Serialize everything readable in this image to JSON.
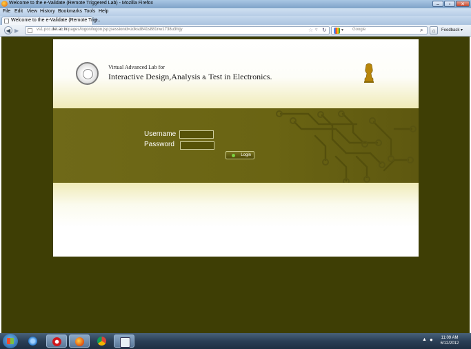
{
  "window": {
    "title": "Welcome to the e-Validate (Remote Triggered Lab) - Mozilla Firefox",
    "controls": [
      "–",
      "▫",
      "✕"
    ]
  },
  "menu": {
    "items": [
      "File",
      "Edit",
      "View",
      "History",
      "Bookmarks",
      "Tools",
      "Help"
    ]
  },
  "tabs": [
    {
      "label": "Welcome to the e-Validate (Remote Trig..."
    }
  ],
  "newtab_label": "+",
  "nav": {
    "url_prefix": "vs1.pcc.",
    "url_domain": "dei.ac.in",
    "url_path": "/pages/logon/logon.jsp;jsessionid=zdksd841s881nw1738u3htjy",
    "search_placeholder": "Google",
    "feedback_label": "Feedback ▾"
  },
  "page": {
    "subtitle": "Virtual Advanced Lab for",
    "title_part1": "Interactive Design,Analysis",
    "title_amp": "&",
    "title_part2": "Test in Electronics.",
    "username_label": "Username",
    "password_label": "Password",
    "login_label": "Login",
    "username_value": "",
    "password_value": ""
  },
  "taskbar": {
    "time": "11:09 AM",
    "date": "6/12/2012"
  },
  "colors": {
    "page_background": "#3e3e05",
    "band": "#6a6413",
    "accent_green": "#7bd040"
  }
}
